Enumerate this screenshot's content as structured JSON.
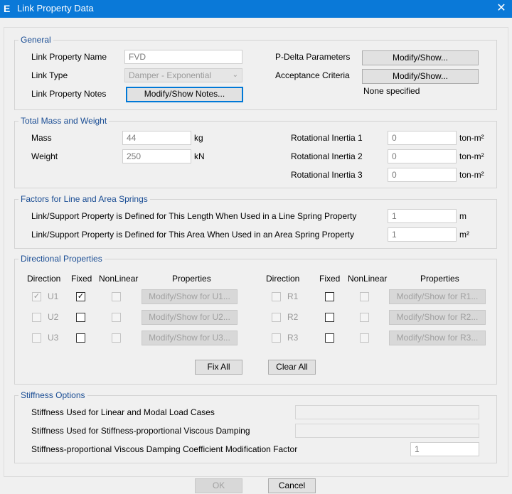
{
  "window": {
    "title": "Link Property Data",
    "logo": "E",
    "close": "✕"
  },
  "general": {
    "title": "General",
    "name_label": "Link Property Name",
    "name_value": "FVD",
    "type_label": "Link Type",
    "type_value": "Damper - Exponential",
    "notes_label": "Link Property Notes",
    "notes_button": "Modify/Show Notes...",
    "pdelta_label": "P-Delta Parameters",
    "pdelta_button": "Modify/Show...",
    "accept_label": "Acceptance Criteria",
    "accept_button": "Modify/Show...",
    "accept_status": "None specified"
  },
  "mass": {
    "title": "Total Mass and Weight",
    "mass_label": "Mass",
    "mass_value": "44",
    "mass_unit": "kg",
    "weight_label": "Weight",
    "weight_value": "250",
    "weight_unit": "kN",
    "ri1_label": "Rotational Inertia 1",
    "ri1_value": "0",
    "ri2_label": "Rotational Inertia 2",
    "ri2_value": "0",
    "ri3_label": "Rotational Inertia 3",
    "ri3_value": "0",
    "ri_unit": "ton-m²"
  },
  "springs": {
    "title": "Factors for Line and Area Springs",
    "line_label": "Link/Support Property is Defined for This Length When Used in a Line Spring Property",
    "line_value": "1",
    "line_unit": "m",
    "area_label": "Link/Support Property is Defined for This Area When Used in an Area Spring Property",
    "area_value": "1",
    "area_unit": "m²"
  },
  "directional": {
    "title": "Directional Properties",
    "headers": {
      "direction": "Direction",
      "fixed": "Fixed",
      "nonlinear": "NonLinear",
      "properties": "Properties"
    },
    "left": [
      {
        "dir": "U1",
        "button": "Modify/Show for U1..."
      },
      {
        "dir": "U2",
        "button": "Modify/Show for U2..."
      },
      {
        "dir": "U3",
        "button": "Modify/Show for U3..."
      }
    ],
    "right": [
      {
        "dir": "R1",
        "button": "Modify/Show for R1..."
      },
      {
        "dir": "R2",
        "button": "Modify/Show for R2..."
      },
      {
        "dir": "R3",
        "button": "Modify/Show for R3..."
      }
    ],
    "check_mark": "✓",
    "fix_all": "Fix All",
    "clear_all": "Clear All"
  },
  "stiffness": {
    "title": "Stiffness Options",
    "linear_label": "Stiffness Used for Linear and Modal Load Cases",
    "linear_value": "",
    "viscous_label": "Stiffness Used for Stiffness-proportional Viscous Damping",
    "viscous_value": "",
    "coef_label": "Stiffness-proportional Viscous Damping Coefficient Modification Factor",
    "coef_value": "1"
  },
  "footer": {
    "ok": "OK",
    "cancel": "Cancel"
  }
}
